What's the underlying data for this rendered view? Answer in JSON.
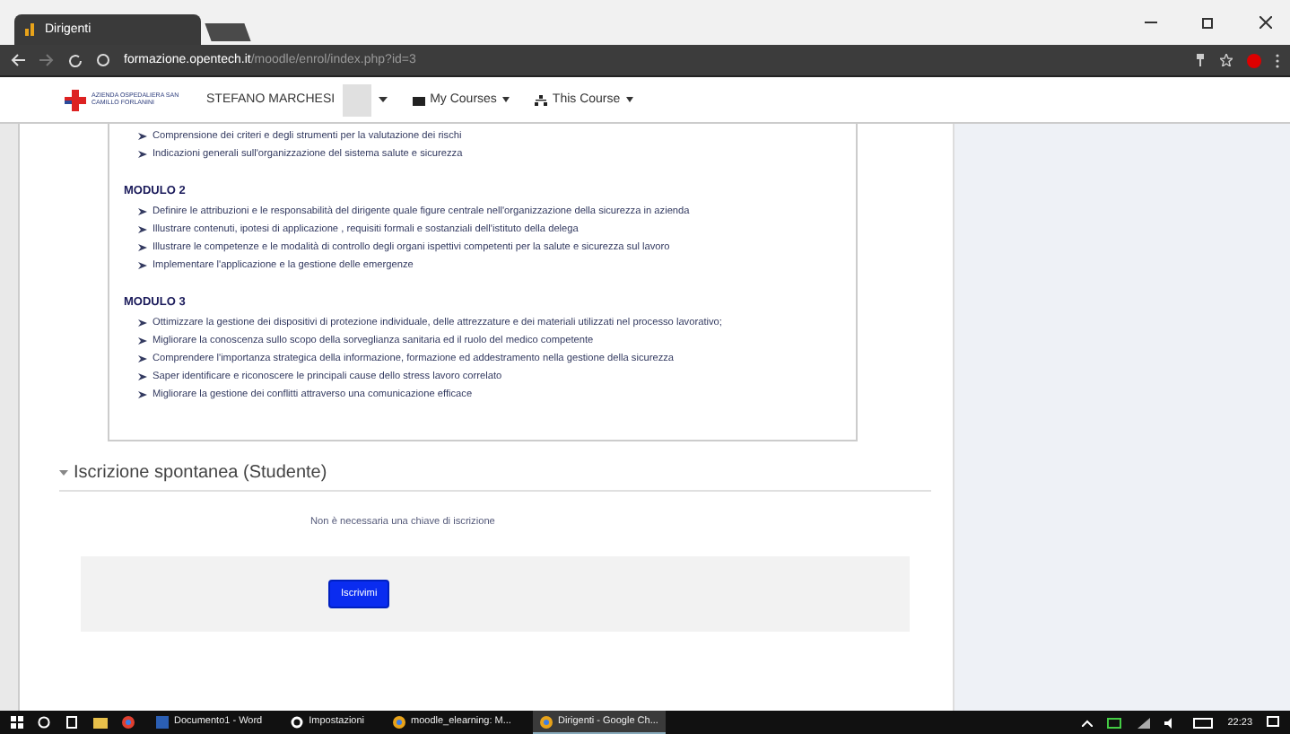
{
  "browser": {
    "tab_title": "Dirigenti",
    "url_host": "formazione.opentech.it",
    "url_path": "/moodle/enrol/index.php?id=3"
  },
  "nav": {
    "logo_text": "AZIENDA OSPEDALIERA SAN CAMILLO FORLANINI",
    "user": "STEFANO MARCHESI",
    "menus": [
      "My Courses",
      "This Course"
    ]
  },
  "modules": [
    {
      "items": [
        "Comprensione dei  criteri e degli strumenti per la valutazione dei rischi",
        "Indicazioni generali sull'organizzazione   del sistema salute e sicurezza"
      ]
    },
    {
      "title": "MODULO 2",
      "items": [
        "Definire le attribuzioni e le responsabilità del dirigente quale figure centrale nell'organizzazione della sicurezza in azienda",
        "Illustrare contenuti, ipotesi di applicazione , requisiti formali e sostanziali dell'istituto della delega",
        "Illustrare le competenze e le modalità di controllo degli organi ispettivi competenti per la salute e sicurezza sul lavoro",
        "Implementare l'applicazione e la gestione delle emergenze"
      ]
    },
    {
      "title": "MODULO 3",
      "items": [
        "Ottimizzare la gestione dei dispositivi di protezione individuale, delle attrezzature e dei materiali utilizzati nel processo lavorativo;",
        "Migliorare la conoscenza sullo scopo della sorveglianza sanitaria ed il ruolo del medico competente",
        "Comprendere l'importanza strategica della informazione, formazione ed addestramento nella gestione della sicurezza",
        "Saper identificare e riconoscere le principali cause dello stress lavoro correlato",
        "Migliorare la gestione dei conflitti attraverso una comunicazione efficace"
      ]
    }
  ],
  "enrol": {
    "heading": "Iscrizione spontanea (Studente)",
    "expanded": true,
    "note": "Non è necessaria una chiave di iscrizione",
    "button": "Iscrivimi"
  },
  "taskbar": {
    "apps": [
      {
        "label": "Documento1 - Word",
        "kind": "word",
        "selected": false
      },
      {
        "label": "Impostazioni",
        "kind": "settings",
        "selected": false
      },
      {
        "label": "moodle_elearning: M...",
        "kind": "chrome",
        "selected": false
      },
      {
        "label": "Dirigenti - Google Ch...",
        "kind": "chrome",
        "selected": true
      }
    ],
    "time": "22:23"
  }
}
